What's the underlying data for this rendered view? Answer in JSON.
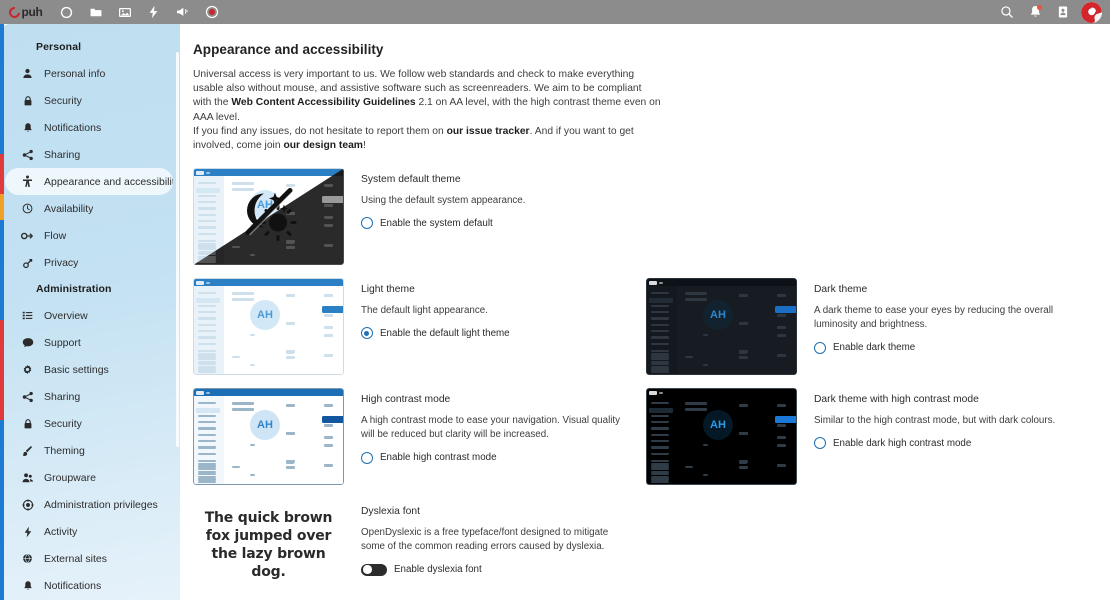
{
  "topbar": {
    "logo_text": "puh",
    "logo_subtext": "",
    "nav_icons": [
      {
        "name": "dashboard-icon",
        "label": "Dashboard"
      },
      {
        "name": "files-icon",
        "label": "Files"
      },
      {
        "name": "photos-icon",
        "label": "Photos"
      },
      {
        "name": "activity-icon",
        "label": "Activity"
      },
      {
        "name": "announcements-icon",
        "label": "Announcements"
      },
      {
        "name": "circles-icon",
        "label": "Circles"
      }
    ],
    "right_icons": [
      {
        "name": "search-icon",
        "label": "Search"
      },
      {
        "name": "notifications-bell-icon",
        "label": "Notifications"
      },
      {
        "name": "contacts-icon",
        "label": "Contacts"
      },
      {
        "name": "user-avatar",
        "label": "Profile"
      }
    ]
  },
  "sidebar": {
    "sections": [
      {
        "title": "Personal",
        "items": [
          {
            "label": "Personal info",
            "icon": "user-icon",
            "active": false
          },
          {
            "label": "Security",
            "icon": "lock-icon",
            "active": false
          },
          {
            "label": "Notifications",
            "icon": "bell-icon",
            "active": false
          },
          {
            "label": "Sharing",
            "icon": "share-icon",
            "active": false
          },
          {
            "label": "Appearance and accessibility",
            "icon": "accessibility-icon",
            "active": true
          },
          {
            "label": "Availability",
            "icon": "clock-icon",
            "active": false
          },
          {
            "label": "Flow",
            "icon": "flow-icon",
            "active": false
          },
          {
            "label": "Privacy",
            "icon": "privacy-icon",
            "active": false
          }
        ]
      },
      {
        "title": "Administration",
        "items": [
          {
            "label": "Overview",
            "icon": "list-icon",
            "active": false
          },
          {
            "label": "Support",
            "icon": "chat-icon",
            "active": false
          },
          {
            "label": "Basic settings",
            "icon": "gear-icon",
            "active": false
          },
          {
            "label": "Sharing",
            "icon": "share-icon",
            "active": false
          },
          {
            "label": "Security",
            "icon": "lock-icon",
            "active": false
          },
          {
            "label": "Theming",
            "icon": "brush-icon",
            "active": false
          },
          {
            "label": "Groupware",
            "icon": "groupware-icon",
            "active": false
          },
          {
            "label": "Administration privileges",
            "icon": "privileges-icon",
            "active": false
          },
          {
            "label": "Activity",
            "icon": "activity-icon",
            "active": false
          },
          {
            "label": "External sites",
            "icon": "globe-icon",
            "active": false
          },
          {
            "label": "Notifications",
            "icon": "bell-icon",
            "active": false
          }
        ]
      }
    ]
  },
  "main": {
    "title": "Appearance and accessibility",
    "description": {
      "line1_a": "Universal access is very important to us. We follow web standards and check to make everything usable also without mouse, and assistive software such as screenreaders. We aim to be compliant with the ",
      "link1": "Web Content Accessibility Guidelines",
      "line1_b": " 2.1 on AA level, with the high contrast theme even on AAA level.",
      "line2_a": "If you find any issues, do not hesitate to report them on ",
      "link2": "our issue tracker",
      "line2_b": ". And if you want to get involved, come join ",
      "link3": "our design team",
      "line2_c": "!"
    },
    "themes": [
      {
        "id": "system-default",
        "title": "System default theme",
        "description": "Using the default system appearance.",
        "option_label": "Enable the system default",
        "selected": false,
        "control": "radio",
        "preview": "split"
      },
      {
        "id": "light",
        "title": "Light theme",
        "description": "The default light appearance.",
        "option_label": "Enable the default light theme",
        "selected": true,
        "control": "radio",
        "preview": "light"
      },
      {
        "id": "dark",
        "title": "Dark theme",
        "description": "A dark theme to ease your eyes by reducing the overall luminosity and brightness.",
        "option_label": "Enable dark theme",
        "selected": false,
        "control": "radio",
        "preview": "dark"
      },
      {
        "id": "high-contrast",
        "title": "High contrast mode",
        "description": "A high contrast mode to ease your navigation. Visual quality will be reduced but clarity will be increased.",
        "option_label": "Enable high contrast mode",
        "selected": false,
        "control": "radio",
        "preview": "light-hc"
      },
      {
        "id": "dark-high-contrast",
        "title": "Dark theme with high contrast mode",
        "description": "Similar to the high contrast mode, but with dark colours.",
        "option_label": "Enable dark high contrast mode",
        "selected": false,
        "control": "radio",
        "preview": "dark-hc"
      }
    ],
    "dyslexia": {
      "preview_text": "The quick brown fox jumped over the lazy brown dog.",
      "title": "Dyslexia font",
      "description": "OpenDyslexic is a free typeface/font designed to mitigate some of the common reading errors caused by dyslexia.",
      "option_label": "Enable dyslexia font",
      "enabled": false,
      "control": "toggle"
    },
    "thumbnail_avatar_initials": "AH"
  },
  "colors": {
    "topbar": "#8c8c8c",
    "sidebar_top": "#bfdff1",
    "sidebar_bottom": "#e6f2fa",
    "accent_blue": "#1f6fb2",
    "brand_red": "#c9252d",
    "rail_blue": "#1e7bd4",
    "rail_red": "#e03b3b",
    "rail_orange": "#f0a024",
    "notification_dot": "#e8543f"
  }
}
